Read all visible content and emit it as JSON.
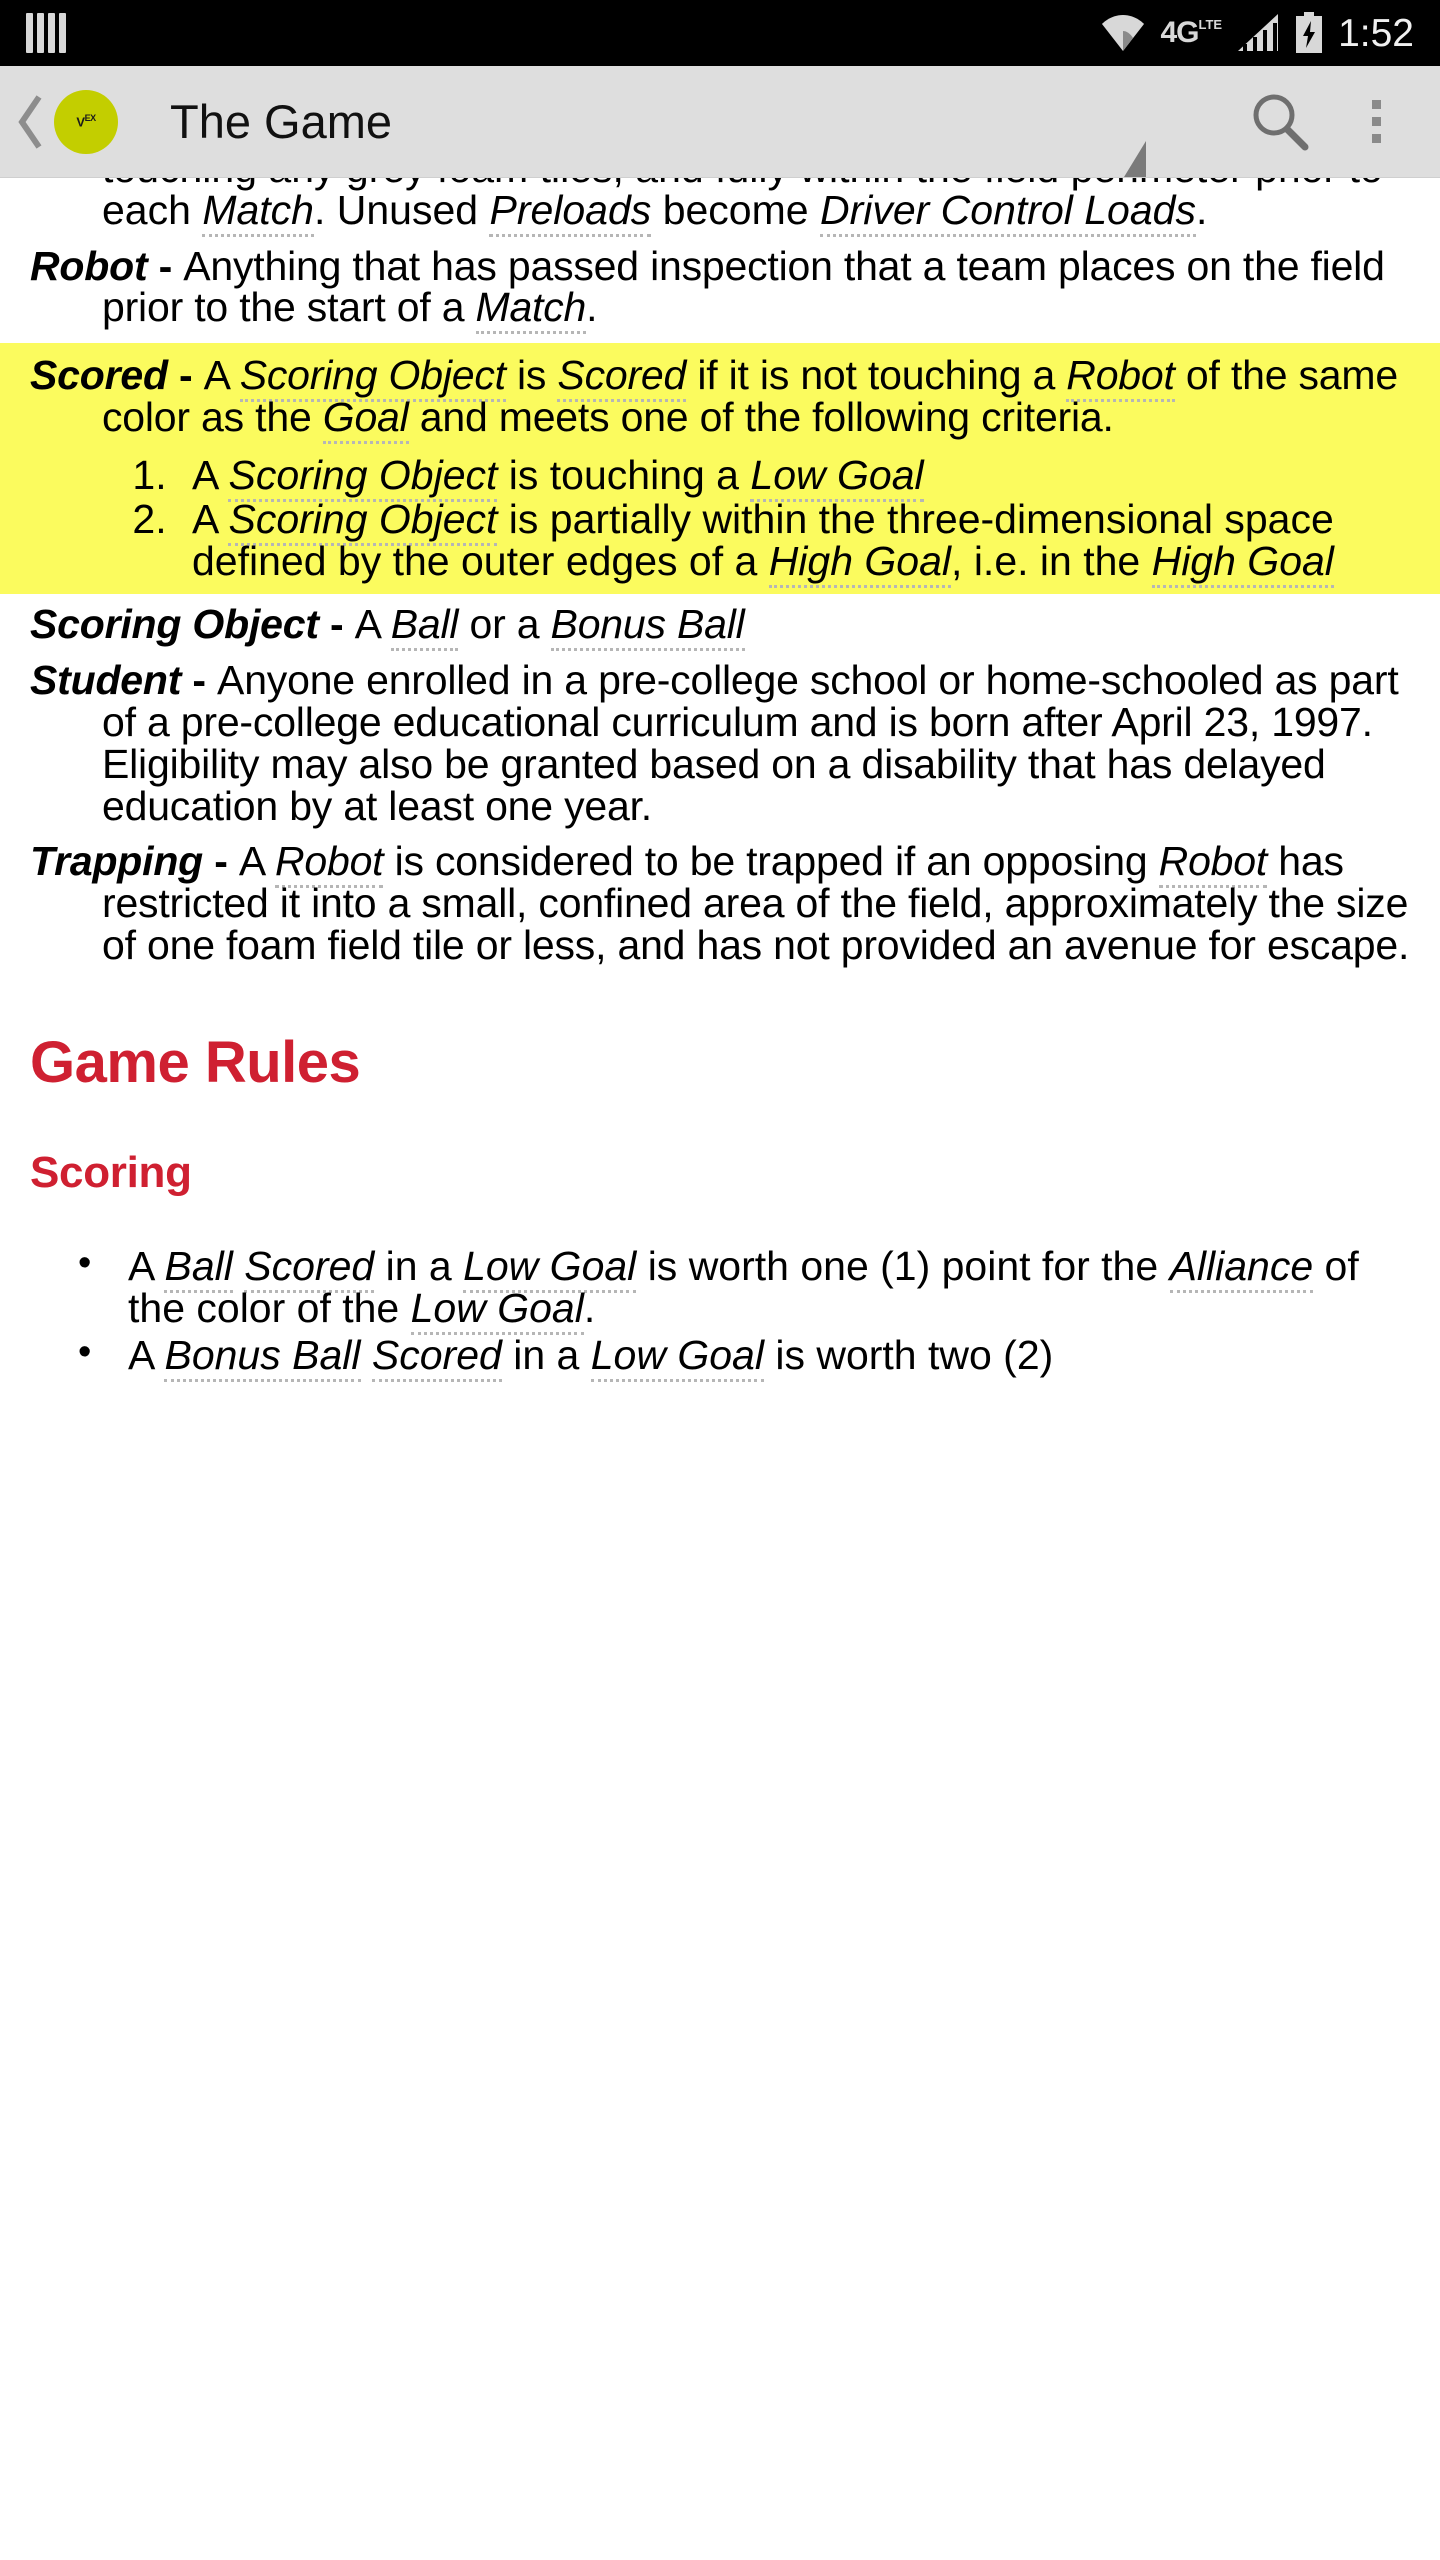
{
  "status_bar": {
    "sim_icon": "sim-card-icon",
    "wifi_icon": "wifi-icon",
    "network_label": "4G",
    "network_sup": "LTE",
    "signal_icon": "cellular-signal-icon",
    "battery_icon": "battery-charging-icon",
    "clock": "1:52"
  },
  "action_bar": {
    "back_icon": "back-chevron-icon",
    "logo_text": "V",
    "logo_sup": "EX",
    "logo_sub": "x",
    "title": "The Game",
    "search_icon": "search-icon",
    "overflow_icon": "overflow-menu-icon",
    "accent_logo_color": "#c3ce00",
    "bar_color": "#dedede"
  },
  "document": {
    "heading_color": "#cf2031",
    "highlight_color": "#fbfb5e",
    "partial_top_paragraph": {
      "line1": "touching any grey foam tiles, and fully within the field",
      "line2_pre": "perimeter prior to each ",
      "line2_term1": "Match",
      "line2_mid": ". Unused ",
      "line2_term2": "Preloads",
      "line3_pre": "become ",
      "line3_term": "Driver Control Loads",
      "line3_post": "."
    },
    "definitions": [
      {
        "term": "Robot",
        "dash": " - ",
        "body_pre": "Anything that has passed inspection that a team places on the field prior to the start of a ",
        "body_term": "Match",
        "body_post": "."
      },
      {
        "term": "Scoring Object",
        "dash": " - ",
        "body_pre": "A ",
        "body_term": "Ball",
        "body_mid": " or a ",
        "body_term2": "Bonus Ball",
        "body_post": ""
      },
      {
        "term": "Student",
        "dash": " - ",
        "body_pre": "Anyone enrolled in a pre-college school or home-schooled as part of a pre-college educational curriculum and is born after April 23, 1997. Eligibility may also be granted based on a disability that has delayed education by at least one year.",
        "body_term": "",
        "body_post": ""
      },
      {
        "term": "Trapping",
        "dash": " - ",
        "body_pre": "A ",
        "body_term": "Robot",
        "body_mid": " is considered to be trapped if an opposing ",
        "body_term2": "Robot",
        "body_post": " has restricted it into a small, confined area of the field, approximately the size of one foam field tile or less, and has not provided an avenue for escape."
      }
    ],
    "highlighted_definition": {
      "term": "Scored",
      "dash": " - ",
      "intro_pre": "A ",
      "intro_term1": "Scoring Object",
      "intro_mid1": " is ",
      "intro_term2": "Scored",
      "intro_mid2": " if it is not touching a ",
      "intro_term3": "Robot",
      "intro_mid3": " of the same color as the ",
      "intro_term4": "Goal",
      "intro_post": " and meets one of the following criteria.",
      "items": [
        {
          "pre": "A ",
          "term1": "Scoring Object",
          "mid1": " is touching a ",
          "term2": "Low Goal",
          "post": ""
        },
        {
          "pre": "A ",
          "term1": "Scoring Object",
          "mid1": " is partially within the three-dimensional space defined by the outer edges of a ",
          "term2": "High Goal",
          "mid2": ", i.e. in the ",
          "term3": "High Goal",
          "post": ""
        }
      ]
    },
    "section_heading": "Game Rules",
    "sub_heading": "Scoring",
    "bullets": [
      {
        "pre": "A ",
        "term1": "Ball",
        "mid0": " ",
        "term1b": "Scored",
        "mid1": " in a ",
        "term2": "Low Goal",
        "mid2": " is worth one (1) point for the ",
        "term3": "Alliance",
        "mid3": " of the color of the ",
        "term4": "Low Goal",
        "post": "."
      },
      {
        "pre": "A ",
        "term1": "Bonus Ball",
        "mid0": " ",
        "term1b": "Scored",
        "mid1": " in a ",
        "term2": "Low Goal",
        "mid2": " is worth two (2)",
        "term3": "",
        "mid3": "",
        "term4": "",
        "post": ""
      }
    ]
  }
}
